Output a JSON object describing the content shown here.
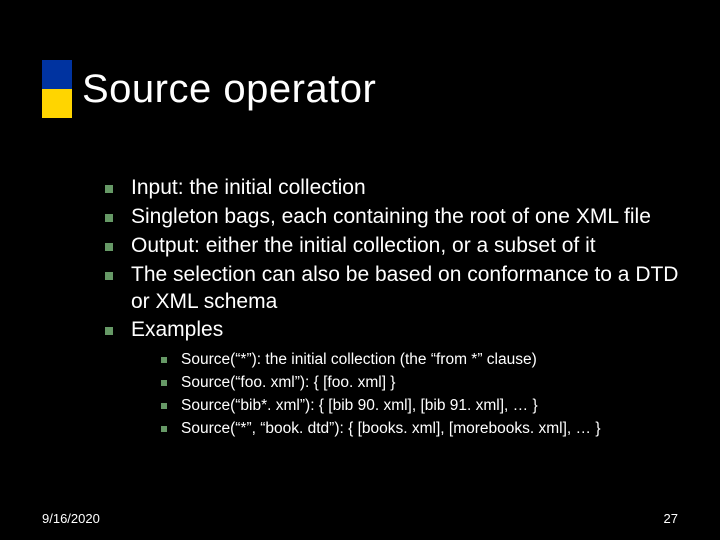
{
  "title": "Source operator",
  "bullets": [
    {
      "text": "Input: the initial collection"
    },
    {
      "text": "Singleton bags, each containing the root of one XML file"
    },
    {
      "text": "Output: either the initial collection, or a subset of it"
    },
    {
      "text": "The selection can also be based on conformance to a DTD or XML schema"
    },
    {
      "text": "Examples",
      "sub": [
        "Source(“*”): the initial collection (the “from *” clause)",
        "Source(“foo. xml”): { [foo. xml] }",
        "Source(“bib*. xml”): { [bib 90. xml], [bib 91. xml], … }",
        "Source(“*”, “book. dtd”): { [books. xml], [morebooks. xml], … }"
      ]
    }
  ],
  "footer": {
    "date": "9/16/2020",
    "page": "27"
  },
  "colors": {
    "bullet": "#669966",
    "accent_blue": "#0033a0",
    "accent_yellow": "#ffd500"
  }
}
